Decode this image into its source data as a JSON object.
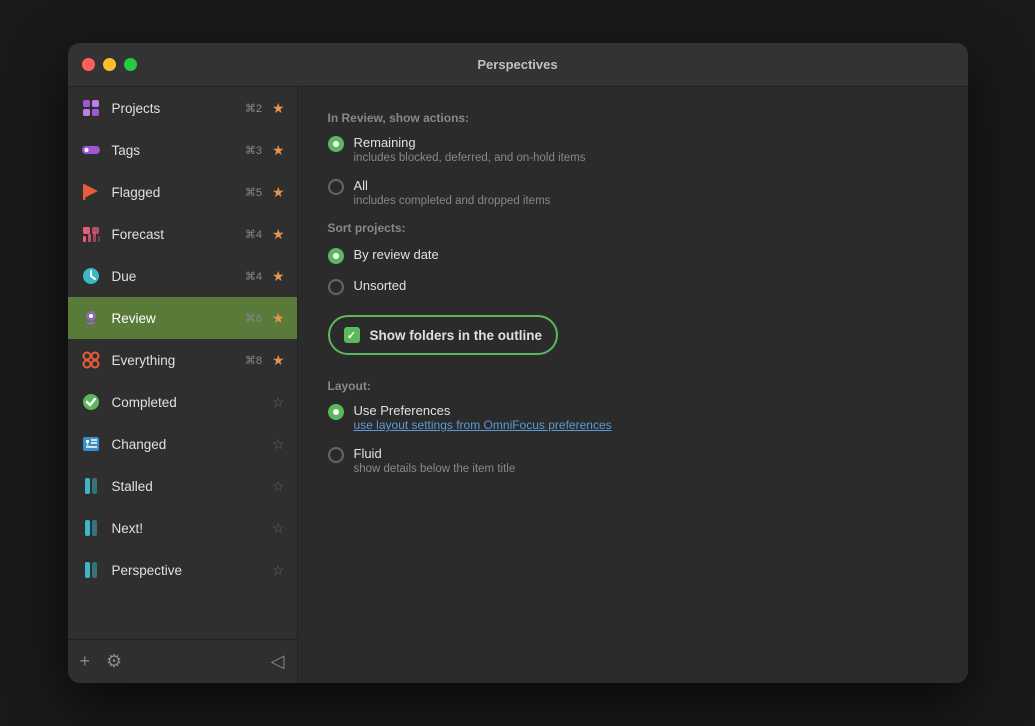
{
  "window": {
    "title": "Perspectives"
  },
  "sidebar": {
    "items": [
      {
        "id": "projects",
        "label": "Projects",
        "shortcut": "⌘2",
        "star": true,
        "icon": "projects-icon",
        "active": false
      },
      {
        "id": "tags",
        "label": "Tags",
        "shortcut": "⌘3",
        "star": true,
        "icon": "tags-icon",
        "active": false
      },
      {
        "id": "flagged",
        "label": "Flagged",
        "shortcut": "⌘5",
        "star": true,
        "icon": "flagged-icon",
        "active": false
      },
      {
        "id": "forecast",
        "label": "Forecast",
        "shortcut": "⌘4",
        "star": true,
        "icon": "forecast-icon",
        "active": false
      },
      {
        "id": "due",
        "label": "Due",
        "shortcut": "⌘4",
        "star": true,
        "icon": "due-icon",
        "active": false
      },
      {
        "id": "review",
        "label": "Review",
        "shortcut": "⌘6",
        "star": true,
        "icon": "review-icon",
        "active": true
      },
      {
        "id": "everything",
        "label": "Everything",
        "shortcut": "⌘8",
        "star": true,
        "icon": "everything-icon",
        "active": false
      },
      {
        "id": "completed",
        "label": "Completed",
        "shortcut": "",
        "star": false,
        "icon": "completed-icon",
        "active": false
      },
      {
        "id": "changed",
        "label": "Changed",
        "shortcut": "",
        "star": false,
        "icon": "changed-icon",
        "active": false
      },
      {
        "id": "stalled",
        "label": "Stalled",
        "shortcut": "",
        "star": false,
        "icon": "stalled-icon",
        "active": false
      },
      {
        "id": "next",
        "label": "Next!",
        "shortcut": "",
        "star": false,
        "icon": "next-icon",
        "active": false
      },
      {
        "id": "perspective",
        "label": "Perspective",
        "shortcut": "",
        "star": false,
        "icon": "perspective-icon",
        "active": false
      }
    ],
    "footer": {
      "add_label": "+",
      "settings_label": "⚙",
      "toggle_label": "◁"
    }
  },
  "detail": {
    "section_show_label": "In Review, show actions:",
    "remaining_label": "Remaining",
    "remaining_sublabel": "includes blocked, deferred, and on-hold items",
    "all_label": "All",
    "all_sublabel": "includes completed and dropped items",
    "sort_section_label": "Sort projects:",
    "by_review_date_label": "By review date",
    "unsorted_label": "Unsorted",
    "show_folders_label": "Show folders in the outline",
    "layout_section_label": "Layout:",
    "use_preferences_label": "Use Preferences",
    "use_preferences_link": "use layout settings from OmniFocus preferences",
    "fluid_label": "Fluid",
    "fluid_sublabel": "show details below the item title"
  }
}
